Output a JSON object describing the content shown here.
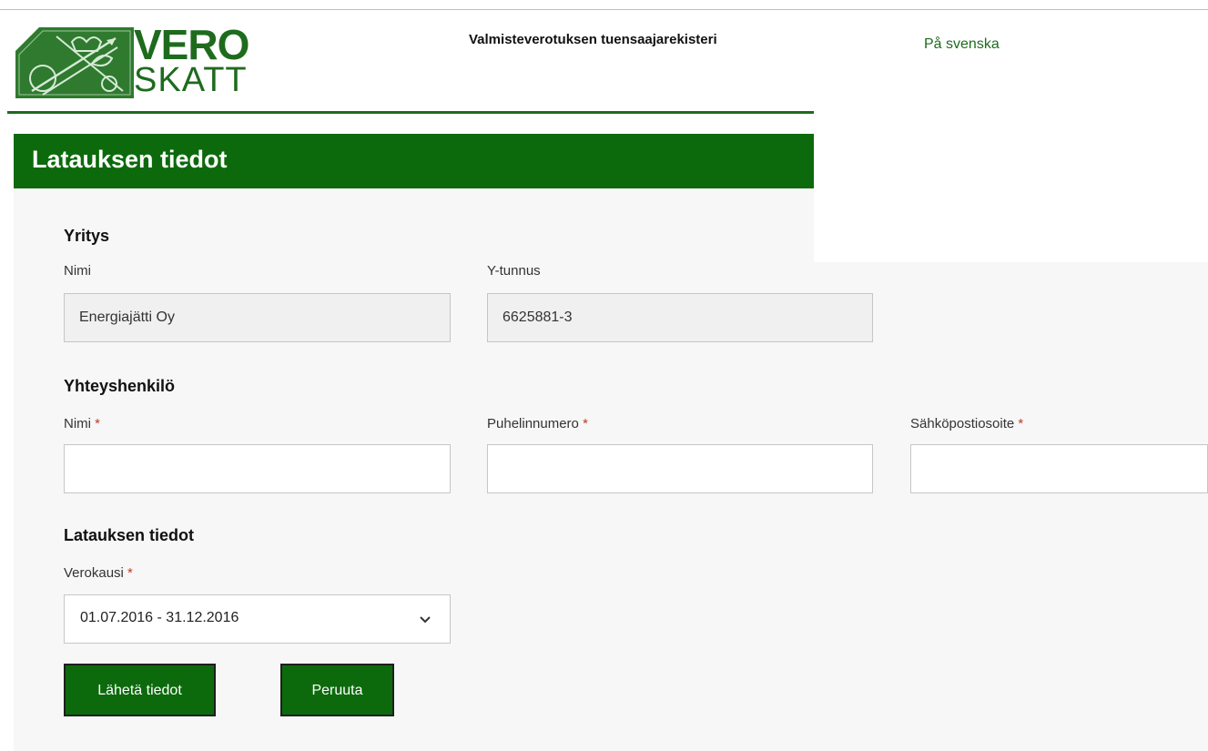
{
  "header": {
    "logo": {
      "text_top": "VERO",
      "text_bottom": "SKATT",
      "emblem_icon": "vero-emblem-icon"
    },
    "app_title": "Valmisteverotuksen tuensaajarekisteri",
    "language_link": "På svenska"
  },
  "page": {
    "title": "Latauksen tiedot"
  },
  "company": {
    "heading": "Yritys",
    "name_label": "Nimi",
    "name_value": "Energiajätti Oy",
    "id_label": "Y-tunnus",
    "id_value": "6625881-3"
  },
  "contact": {
    "heading": "Yhteyshenkilö",
    "name_label": "Nimi",
    "phone_label": "Puhelinnumero",
    "email_label": "Sähköpostiosoite",
    "required_marker": "*",
    "name_value": "",
    "phone_value": "",
    "email_value": ""
  },
  "load": {
    "heading": "Latauksen tiedot",
    "period_label": "Verokausi",
    "period_selected": "01.07.2016 - 31.12.2016",
    "chevron_icon": "chevron-down-icon"
  },
  "actions": {
    "submit_label": "Lähetä tiedot",
    "cancel_label": "Peruuta"
  },
  "colors": {
    "brand_green": "#0c6a0c",
    "logo_green": "#1e6b1e",
    "required_red": "#c0392b"
  }
}
